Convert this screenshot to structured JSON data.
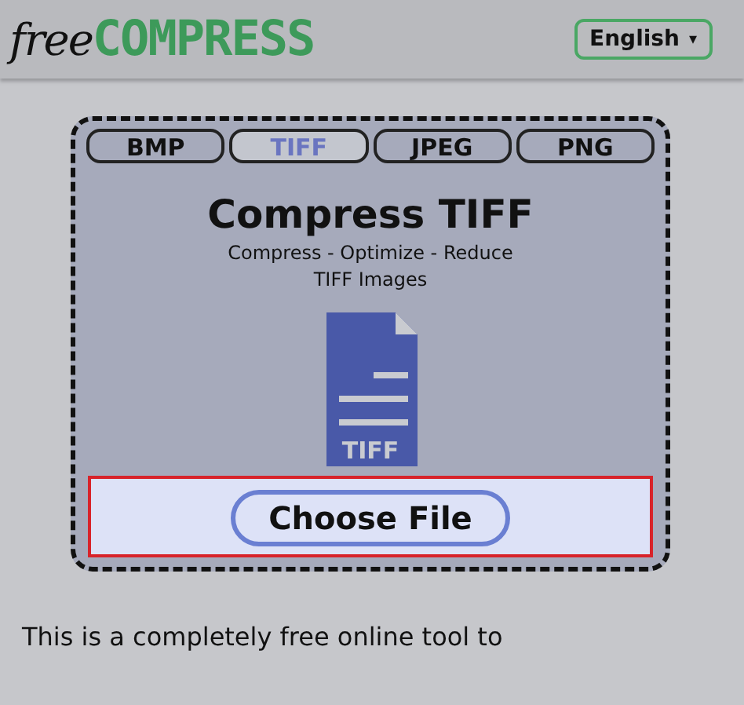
{
  "header": {
    "logo": {
      "prefix": "free",
      "name": "COMPRESS"
    },
    "language": {
      "label": "English",
      "caret": "▾"
    }
  },
  "tool": {
    "tabs": [
      {
        "label": "BMP",
        "selected": false
      },
      {
        "label": "TIFF",
        "selected": true
      },
      {
        "label": "JPEG",
        "selected": false
      },
      {
        "label": "PNG",
        "selected": false
      }
    ],
    "title": "Compress TIFF",
    "subtitle_lines": [
      "Compress - Optimize - Reduce",
      "TIFF Images"
    ],
    "file_icon_label": "TIFF",
    "upload": {
      "button": "Choose File",
      "highlighted": true
    }
  },
  "intro": "This is a completely free online tool to"
}
